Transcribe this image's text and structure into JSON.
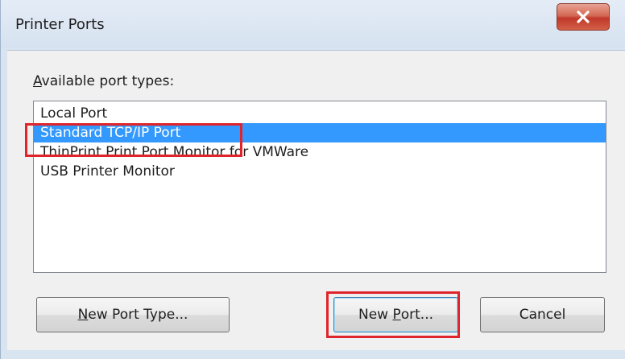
{
  "window": {
    "title": "Printer Ports",
    "close_icon": "close-icon"
  },
  "port_types": {
    "label_accel": "A",
    "label_rest": "vailable port types:",
    "items": [
      "Local Port",
      "Standard TCP/IP Port",
      "ThinPrint Print Port Monitor for VMWare",
      "USB Printer Monitor"
    ],
    "selected_index": 1
  },
  "buttons": {
    "new_port_type_accel": "N",
    "new_port_type_rest": "ew Port Type...",
    "new_port_pre": "New ",
    "new_port_accel": "P",
    "new_port_rest": "ort...",
    "cancel": "Cancel"
  },
  "colors": {
    "selection": "#3399ff",
    "annotation_highlight": "#e0242c",
    "close_button": "#c0392b"
  }
}
